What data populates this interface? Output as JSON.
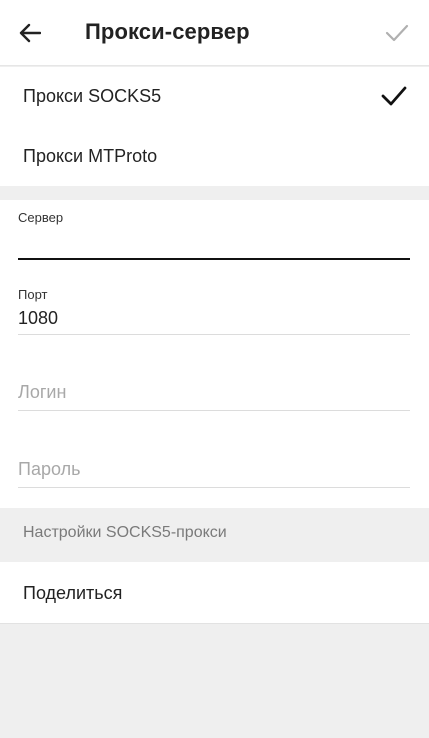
{
  "header": {
    "title": "Прокси-сервер",
    "back_icon": "arrow-left-icon",
    "done_icon": "checkmark-icon"
  },
  "proxy_types": [
    {
      "label": "Прокси SOCKS5",
      "selected": true
    },
    {
      "label": "Прокси MTProto",
      "selected": false
    }
  ],
  "form": {
    "server": {
      "label": "Сервер",
      "value": ""
    },
    "port": {
      "label": "Порт",
      "value": "1080"
    },
    "login": {
      "placeholder": "Логин",
      "value": ""
    },
    "password": {
      "placeholder": "Пароль",
      "value": ""
    }
  },
  "settings_header": "Настройки SOCKS5-прокси",
  "share": {
    "label": "Поделиться"
  },
  "colors": {
    "background": "#efefef",
    "surface": "#ffffff",
    "text": "#222222",
    "muted": "#7a7a7a",
    "disabled_icon": "#b0b0b0"
  }
}
